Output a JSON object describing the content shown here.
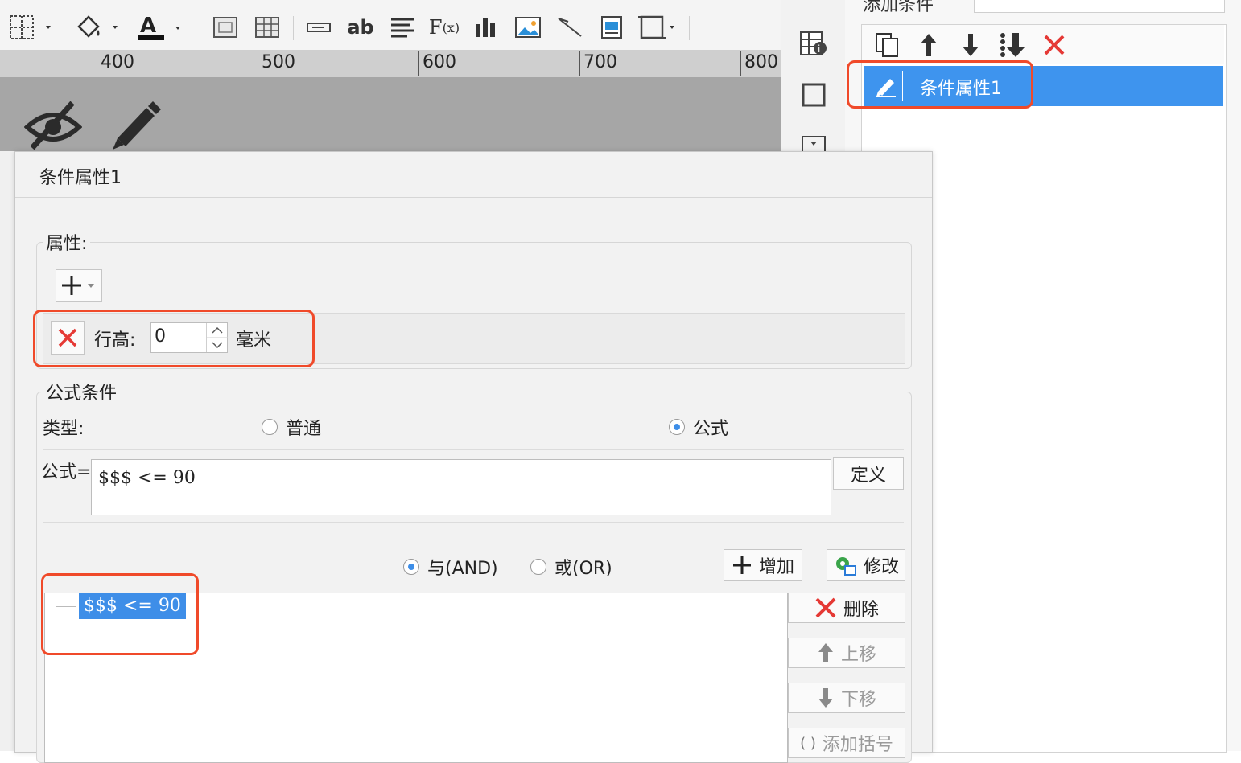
{
  "ruler": {
    "ticks": [
      "400",
      "500",
      "600",
      "700",
      "800"
    ]
  },
  "right_panel": {
    "header_label": "添加条件",
    "condition_item": "条件属性1"
  },
  "dialog": {
    "title": "条件属性1",
    "attributes": {
      "legend": "属性:",
      "row_height_label": "行高:",
      "row_height_value": "0",
      "row_height_unit": "毫米"
    },
    "formula_condition": {
      "legend": "公式条件",
      "type_label": "类型:",
      "type_options": [
        "普通",
        "公式"
      ],
      "type_selected": "公式",
      "formula_label": "公式=",
      "formula_value": "$$$ <= 90",
      "define_button": "定义",
      "logic_options": [
        "与(AND)",
        "或(OR)"
      ],
      "logic_selected": "与(AND)",
      "add_button": "增加",
      "modify_button": "修改",
      "tree_items": [
        "$$$ <= 90"
      ],
      "delete_button": "删除",
      "move_up_button": "上移",
      "move_down_button": "下移",
      "add_bracket_button": "添加括号"
    }
  },
  "colors": {
    "selection": "#3e94ee",
    "highlight_border": "#f04a2a",
    "delete_red": "#e53935"
  }
}
